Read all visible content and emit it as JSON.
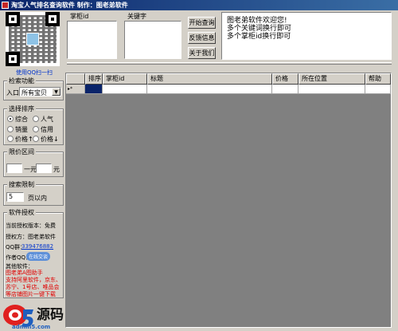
{
  "window": {
    "title": "淘宝人气排名查询软件   制作：图老弟软件"
  },
  "qr": {
    "caption": "使用QQ扫一扫"
  },
  "inputs": {
    "shopkeeper_label": "掌柜id",
    "keyword_label": "关键字",
    "shopkeeper_value": "",
    "keyword_value": ""
  },
  "buttons": {
    "start": "开始查询",
    "feedback": "反馈信息",
    "about": "关于我们"
  },
  "info_text": [
    "图老弟软件欢迎您!",
    "多个关键词换行即可",
    "多个掌柜id换行即可"
  ],
  "search_function": {
    "title": "检索功能",
    "entry_label": "入口:",
    "entry_value": "所有宝贝"
  },
  "sort": {
    "title": "选择排序",
    "options": [
      {
        "label": "综合",
        "selected": true
      },
      {
        "label": "人气",
        "selected": false
      },
      {
        "label": "销量",
        "selected": false
      },
      {
        "label": "信用",
        "selected": false
      },
      {
        "label": "价格↑",
        "selected": false
      },
      {
        "label": "价格↓",
        "selected": false
      }
    ]
  },
  "price_range": {
    "title": "限价区间",
    "separator": "一元",
    "unit": "元",
    "min_value": "",
    "max_value": ""
  },
  "search_limit": {
    "title": "搜索限制",
    "value": "5",
    "unit": "页以内"
  },
  "license": {
    "title": "软件授权",
    "version": "当前授权版本：免费",
    "licensor": "授权方：图老弟软件",
    "qq_group_label": "QQ群：",
    "qq_group_value": "339476882",
    "author_qq_label": "作者QQ：",
    "chat_badge": "在线交谈",
    "other_label": "其他软件：",
    "promo": [
      "图老弟A图助手",
      "支持阿里软件，京东、",
      "苏宁、1号店、唯品会",
      "等店铺图片一键下载"
    ]
  },
  "table": {
    "columns": [
      "排序",
      "掌柜id",
      "标题",
      "价格",
      "所在位置",
      "帮助"
    ],
    "row_marker": "▸*"
  },
  "watermark": {
    "text": "源码",
    "domain": "admin5.com"
  },
  "colors": {
    "title_bar": "#0a246a",
    "link": "#0033cc",
    "promo": "#e00000",
    "grid_bg": "#808080",
    "selected_cell": "#0a246a"
  }
}
